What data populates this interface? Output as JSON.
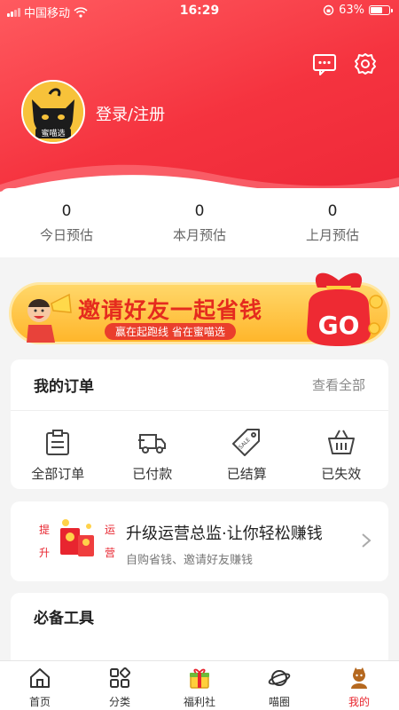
{
  "status_bar": {
    "carrier": "中国移动",
    "time": "16:29",
    "battery": "63%",
    "battery_level": 0.63
  },
  "profile": {
    "login_text": "登录/注册",
    "avatar_caption": "蜜喵选"
  },
  "stats": [
    {
      "value": "0",
      "label": "今日预估"
    },
    {
      "value": "0",
      "label": "本月预估"
    },
    {
      "value": "0",
      "label": "上月预估"
    }
  ],
  "banner": {
    "title": "邀请好友一起省钱",
    "subtitle": "赢在起跑线  省在蜜喵选",
    "go": "GO"
  },
  "orders": {
    "title": "我的订单",
    "view_all": "查看全部",
    "items": [
      {
        "label": "全部订单",
        "icon": "clipboard-icon"
      },
      {
        "label": "已付款",
        "icon": "truck-icon"
      },
      {
        "label": "已结算",
        "icon": "tag-icon"
      },
      {
        "label": "已失效",
        "icon": "basket-icon"
      }
    ]
  },
  "promo": {
    "title": "升级运营总监·让你轻松赚钱",
    "subtitle": "自购省钱、邀请好友赚钱",
    "badge_left_top": "提",
    "badge_left_bottom": "升",
    "badge_right_top": "运",
    "badge_right_bottom": "营"
  },
  "tools": {
    "title": "必备工具"
  },
  "tabbar": [
    {
      "label": "首页",
      "icon": "home-icon",
      "active": false
    },
    {
      "label": "分类",
      "icon": "category-icon",
      "active": false
    },
    {
      "label": "福利社",
      "icon": "gift-icon",
      "active": false
    },
    {
      "label": "喵圈",
      "icon": "planet-icon",
      "active": false
    },
    {
      "label": "我的",
      "icon": "profile-icon",
      "active": true
    }
  ],
  "colors": {
    "brand_red": "#f5333f",
    "tab_active": "#e8262e"
  }
}
